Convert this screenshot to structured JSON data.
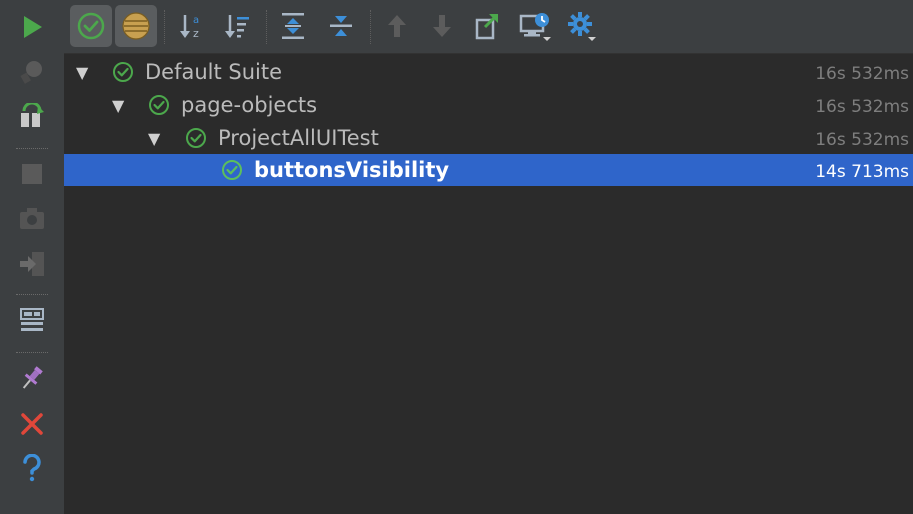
{
  "left_toolbar": {
    "tools": [
      {
        "name": "run-icon",
        "color": "#4ca84c"
      },
      {
        "name": "debug-icon"
      },
      {
        "name": "rerun-icon",
        "color": "#4ca84c"
      },
      {
        "name": "stop-icon"
      },
      {
        "name": "camera-icon"
      },
      {
        "name": "exit-icon"
      },
      {
        "name": "layout-icon"
      },
      {
        "name": "pin-icon",
        "color": "#a070c0"
      },
      {
        "name": "close-icon",
        "color": "#e0473a"
      },
      {
        "name": "help-icon",
        "color": "#3d8fd8"
      }
    ]
  },
  "top_toolbar": {
    "tools": [
      {
        "name": "show-passed-icon",
        "active": true
      },
      {
        "name": "show-ignored-icon",
        "active": true
      },
      {
        "name": "sort-alphabetically-icon"
      },
      {
        "name": "sort-by-duration-icon"
      },
      {
        "name": "expand-all-icon"
      },
      {
        "name": "collapse-all-icon"
      },
      {
        "name": "previous-failed-icon"
      },
      {
        "name": "next-failed-icon"
      },
      {
        "name": "export-results-icon"
      },
      {
        "name": "test-history-icon"
      },
      {
        "name": "settings-icon"
      }
    ]
  },
  "tree": {
    "nodes": [
      {
        "label": "Default Suite",
        "time": "16s 532ms",
        "status": "passed",
        "expanded": true
      },
      {
        "label": "page-objects",
        "time": "16s 532ms",
        "status": "passed",
        "expanded": true
      },
      {
        "label": "ProjectAllUITest",
        "time": "16s 532ms",
        "status": "passed",
        "expanded": true
      },
      {
        "label": "buttonsVisibility",
        "time": "14s 713ms",
        "status": "passed",
        "selected": true
      }
    ]
  },
  "colors": {
    "passed": "#4ca84c",
    "selection": "#2f65ca",
    "accent_blue": "#3d8fd8"
  }
}
